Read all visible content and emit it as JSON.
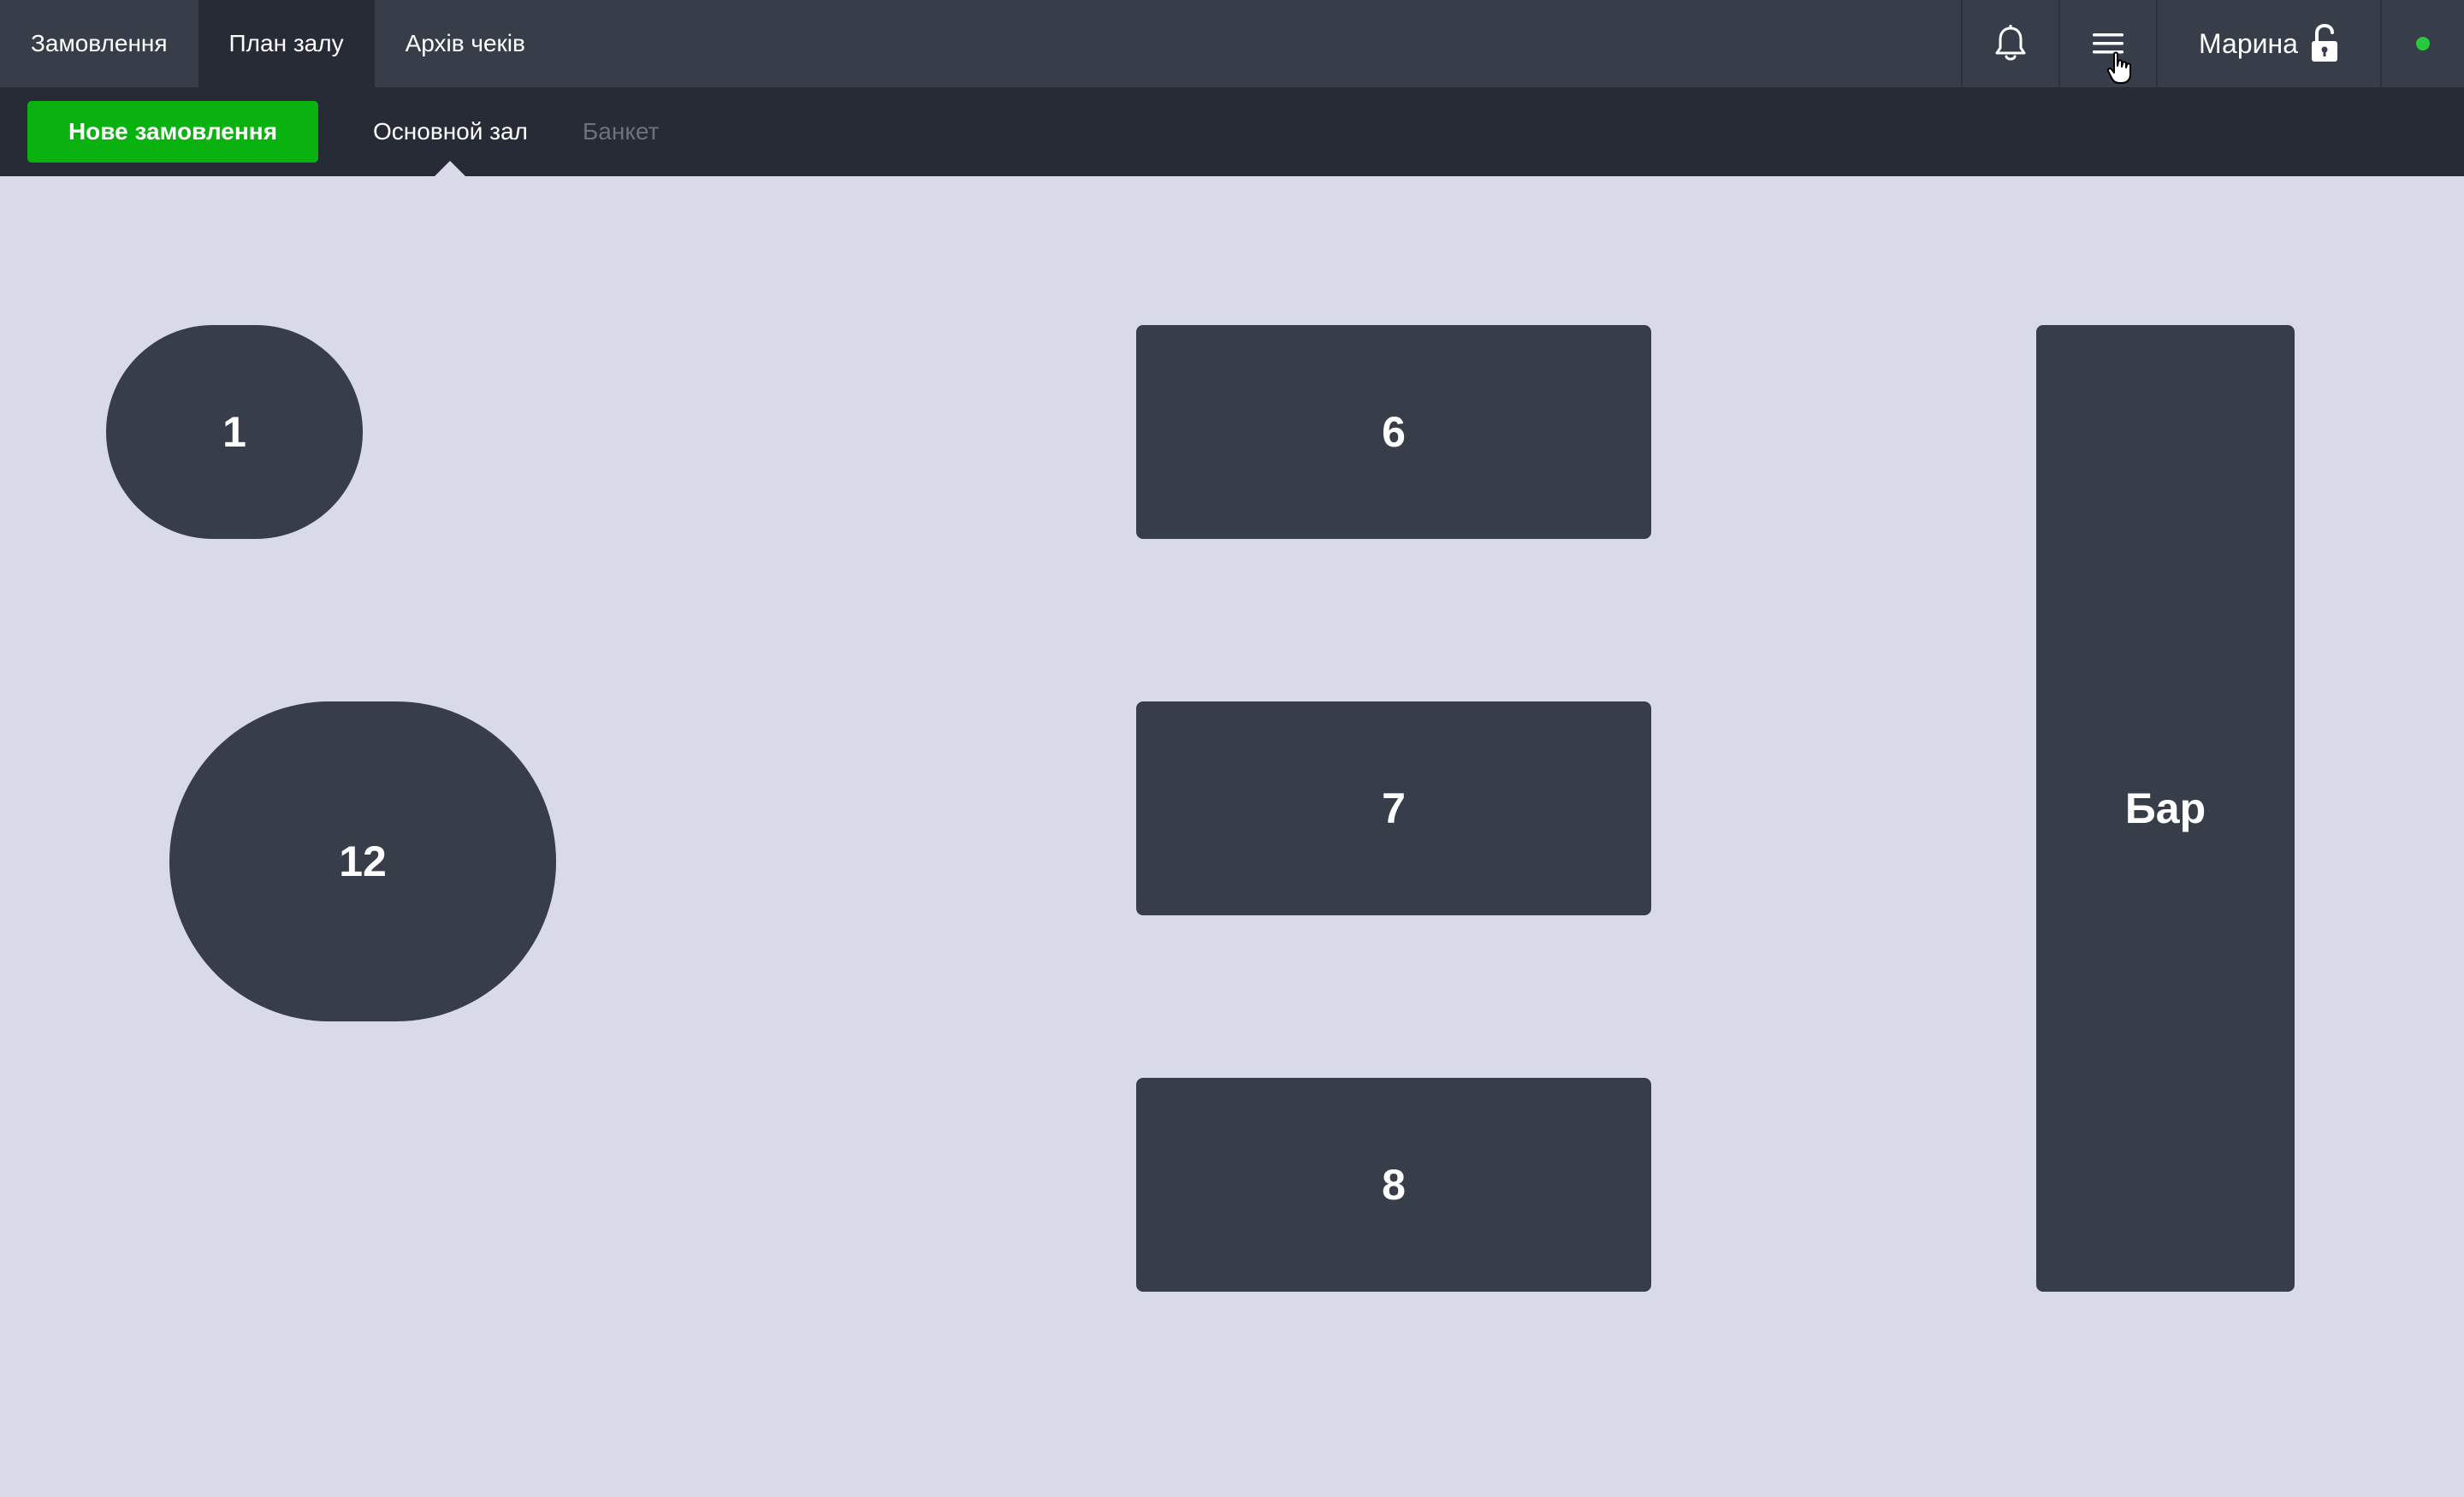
{
  "topnav": {
    "tabs": [
      {
        "label": "Замовлення",
        "active": false
      },
      {
        "label": "План залу",
        "active": true
      },
      {
        "label": "Архів чеків",
        "active": false
      }
    ],
    "icons": {
      "bell": "bell-icon",
      "menu": "hamburger-menu-icon",
      "lock": "unlocked-padlock-icon"
    },
    "user_name": "Марина",
    "status_color": "#28c93f"
  },
  "subbar": {
    "new_order_label": "Нове замовлення",
    "hall_tabs": [
      {
        "label": "Основной зал",
        "active": true
      },
      {
        "label": "Банкет",
        "active": false
      }
    ]
  },
  "floor_plan": {
    "tables": [
      {
        "id": "1",
        "label": "1",
        "shape": "round"
      },
      {
        "id": "12",
        "label": "12",
        "shape": "round"
      },
      {
        "id": "6",
        "label": "6",
        "shape": "rect"
      },
      {
        "id": "7",
        "label": "7",
        "shape": "rect"
      },
      {
        "id": "8",
        "label": "8",
        "shape": "rect"
      },
      {
        "id": "bar",
        "label": "Бар",
        "shape": "rect"
      }
    ]
  },
  "colors": {
    "topbar": "#373d49",
    "subbar": "#262b36",
    "accent_green": "#09b20f",
    "floor": "#d8dae7",
    "table": "#373d49"
  }
}
